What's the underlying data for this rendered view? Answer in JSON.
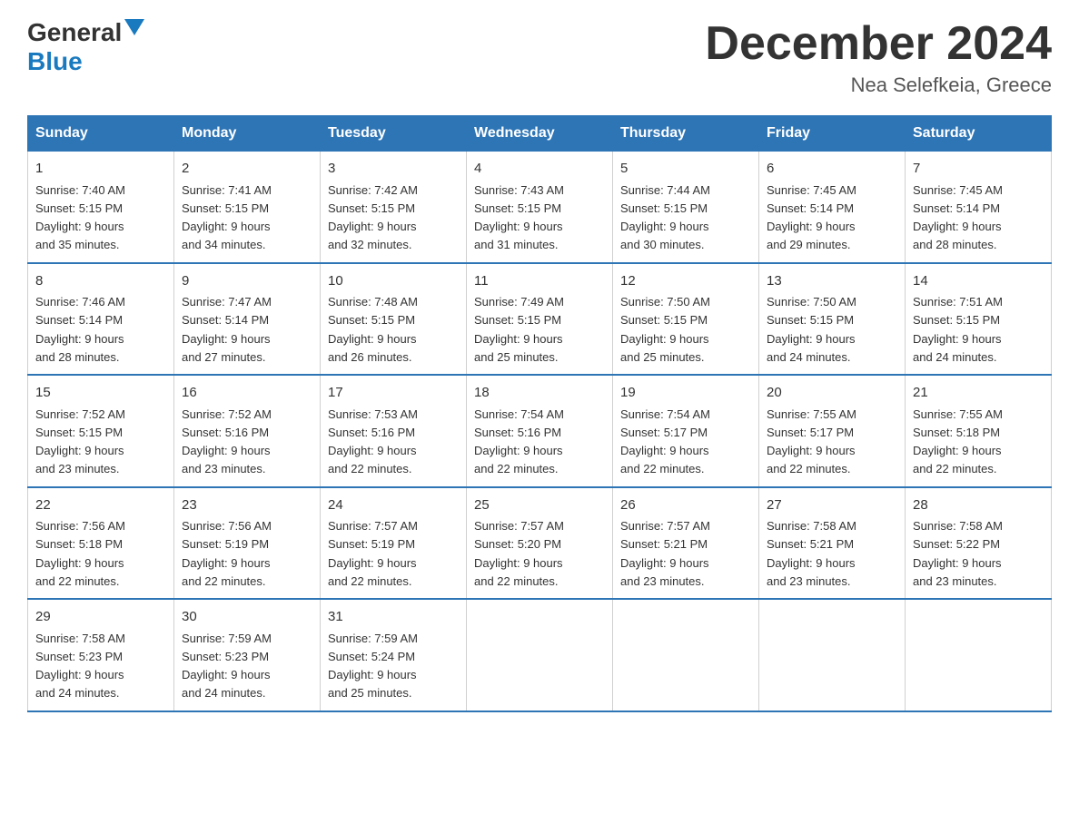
{
  "logo": {
    "general": "General",
    "blue": "Blue",
    "triangle_symbol": "▶"
  },
  "title": "December 2024",
  "location": "Nea Selefkeia, Greece",
  "days_of_week": [
    "Sunday",
    "Monday",
    "Tuesday",
    "Wednesday",
    "Thursday",
    "Friday",
    "Saturday"
  ],
  "weeks": [
    [
      {
        "day": "1",
        "sunrise": "7:40 AM",
        "sunset": "5:15 PM",
        "daylight": "9 hours and 35 minutes."
      },
      {
        "day": "2",
        "sunrise": "7:41 AM",
        "sunset": "5:15 PM",
        "daylight": "9 hours and 34 minutes."
      },
      {
        "day": "3",
        "sunrise": "7:42 AM",
        "sunset": "5:15 PM",
        "daylight": "9 hours and 32 minutes."
      },
      {
        "day": "4",
        "sunrise": "7:43 AM",
        "sunset": "5:15 PM",
        "daylight": "9 hours and 31 minutes."
      },
      {
        "day": "5",
        "sunrise": "7:44 AM",
        "sunset": "5:15 PM",
        "daylight": "9 hours and 30 minutes."
      },
      {
        "day": "6",
        "sunrise": "7:45 AM",
        "sunset": "5:14 PM",
        "daylight": "9 hours and 29 minutes."
      },
      {
        "day": "7",
        "sunrise": "7:45 AM",
        "sunset": "5:14 PM",
        "daylight": "9 hours and 28 minutes."
      }
    ],
    [
      {
        "day": "8",
        "sunrise": "7:46 AM",
        "sunset": "5:14 PM",
        "daylight": "9 hours and 28 minutes."
      },
      {
        "day": "9",
        "sunrise": "7:47 AM",
        "sunset": "5:14 PM",
        "daylight": "9 hours and 27 minutes."
      },
      {
        "day": "10",
        "sunrise": "7:48 AM",
        "sunset": "5:15 PM",
        "daylight": "9 hours and 26 minutes."
      },
      {
        "day": "11",
        "sunrise": "7:49 AM",
        "sunset": "5:15 PM",
        "daylight": "9 hours and 25 minutes."
      },
      {
        "day": "12",
        "sunrise": "7:50 AM",
        "sunset": "5:15 PM",
        "daylight": "9 hours and 25 minutes."
      },
      {
        "day": "13",
        "sunrise": "7:50 AM",
        "sunset": "5:15 PM",
        "daylight": "9 hours and 24 minutes."
      },
      {
        "day": "14",
        "sunrise": "7:51 AM",
        "sunset": "5:15 PM",
        "daylight": "9 hours and 24 minutes."
      }
    ],
    [
      {
        "day": "15",
        "sunrise": "7:52 AM",
        "sunset": "5:15 PM",
        "daylight": "9 hours and 23 minutes."
      },
      {
        "day": "16",
        "sunrise": "7:52 AM",
        "sunset": "5:16 PM",
        "daylight": "9 hours and 23 minutes."
      },
      {
        "day": "17",
        "sunrise": "7:53 AM",
        "sunset": "5:16 PM",
        "daylight": "9 hours and 22 minutes."
      },
      {
        "day": "18",
        "sunrise": "7:54 AM",
        "sunset": "5:16 PM",
        "daylight": "9 hours and 22 minutes."
      },
      {
        "day": "19",
        "sunrise": "7:54 AM",
        "sunset": "5:17 PM",
        "daylight": "9 hours and 22 minutes."
      },
      {
        "day": "20",
        "sunrise": "7:55 AM",
        "sunset": "5:17 PM",
        "daylight": "9 hours and 22 minutes."
      },
      {
        "day": "21",
        "sunrise": "7:55 AM",
        "sunset": "5:18 PM",
        "daylight": "9 hours and 22 minutes."
      }
    ],
    [
      {
        "day": "22",
        "sunrise": "7:56 AM",
        "sunset": "5:18 PM",
        "daylight": "9 hours and 22 minutes."
      },
      {
        "day": "23",
        "sunrise": "7:56 AM",
        "sunset": "5:19 PM",
        "daylight": "9 hours and 22 minutes."
      },
      {
        "day": "24",
        "sunrise": "7:57 AM",
        "sunset": "5:19 PM",
        "daylight": "9 hours and 22 minutes."
      },
      {
        "day": "25",
        "sunrise": "7:57 AM",
        "sunset": "5:20 PM",
        "daylight": "9 hours and 22 minutes."
      },
      {
        "day": "26",
        "sunrise": "7:57 AM",
        "sunset": "5:21 PM",
        "daylight": "9 hours and 23 minutes."
      },
      {
        "day": "27",
        "sunrise": "7:58 AM",
        "sunset": "5:21 PM",
        "daylight": "9 hours and 23 minutes."
      },
      {
        "day": "28",
        "sunrise": "7:58 AM",
        "sunset": "5:22 PM",
        "daylight": "9 hours and 23 minutes."
      }
    ],
    [
      {
        "day": "29",
        "sunrise": "7:58 AM",
        "sunset": "5:23 PM",
        "daylight": "9 hours and 24 minutes."
      },
      {
        "day": "30",
        "sunrise": "7:59 AM",
        "sunset": "5:23 PM",
        "daylight": "9 hours and 24 minutes."
      },
      {
        "day": "31",
        "sunrise": "7:59 AM",
        "sunset": "5:24 PM",
        "daylight": "9 hours and 25 minutes."
      },
      null,
      null,
      null,
      null
    ]
  ],
  "labels": {
    "sunrise_prefix": "Sunrise: ",
    "sunset_prefix": "Sunset: ",
    "daylight_prefix": "Daylight: "
  }
}
